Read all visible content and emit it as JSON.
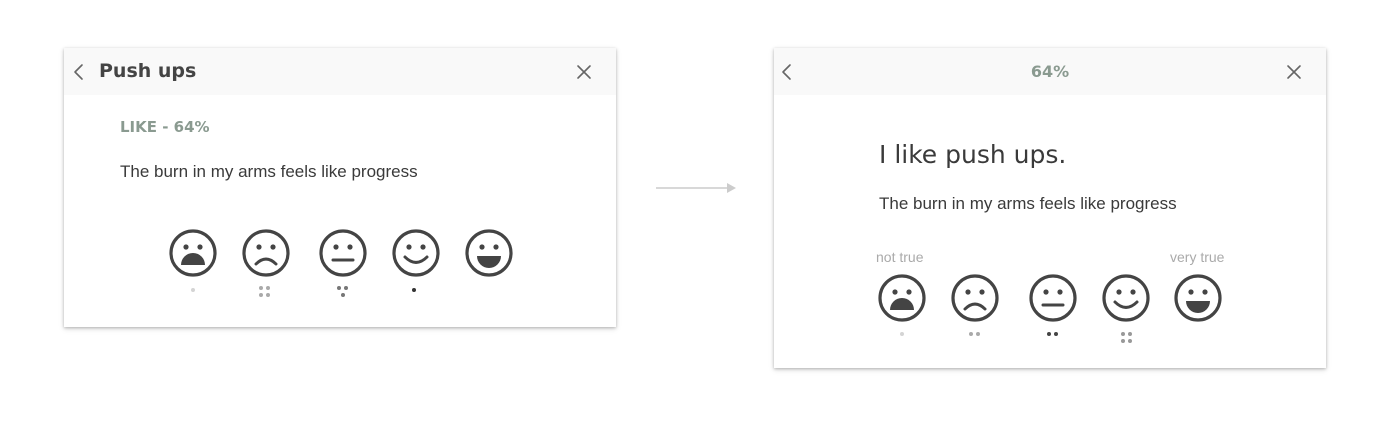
{
  "left_card": {
    "title": "Push ups",
    "like_label": "LIKE - 64%",
    "description": "The burn in my arms feels like progress"
  },
  "right_card": {
    "title": "64%",
    "statement": "I like push ups.",
    "description": "The burn in my arms feels like progress",
    "scale_low": "not true",
    "scale_high": "very true"
  },
  "faces": [
    "very-sad-face",
    "sad-face",
    "neutral-face",
    "smile-face",
    "big-smile-face"
  ],
  "dot_indicators_left": [
    1,
    4,
    3,
    1,
    0
  ],
  "dot_indicators_right": [
    1,
    2,
    2,
    4,
    0
  ],
  "colors": {
    "accent_gray_green": "#8a9a90",
    "header_bg": "#f9f9f9",
    "icon": "#444444",
    "scale_text": "#aaaaaa",
    "arrow": "#cccccc"
  }
}
